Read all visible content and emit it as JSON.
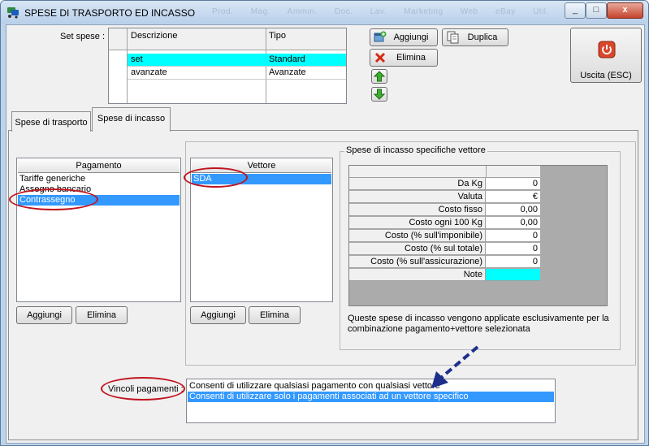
{
  "window": {
    "title": "SPESE DI TRASPORTO ED INCASSO",
    "background_menu": [
      "Prod.",
      "Mag.",
      "Ammin.",
      "Doc.",
      "Lav.",
      "Marketing",
      "Web",
      "eBay",
      "Util."
    ],
    "buttons": {
      "minimize": "_",
      "maximize": "□",
      "close": "x"
    }
  },
  "set_spese": {
    "label": "Set spese :",
    "columns": [
      "Descrizione",
      "Tipo"
    ],
    "rows": [
      {
        "descrizione": "set",
        "tipo": "Standard"
      },
      {
        "descrizione": "avanzate",
        "tipo": "Avanzate"
      }
    ]
  },
  "toolbar": {
    "aggiungi": "Aggiungi",
    "duplica": "Duplica",
    "elimina": "Elimina",
    "uscita": "Uscita (ESC)"
  },
  "tabs": [
    "Spese di trasporto",
    "Spese di incasso"
  ],
  "pagamento": {
    "header": "Pagamento",
    "items": [
      "Tariffe generiche",
      "Assegno bancario",
      "Contrassegno"
    ],
    "aggiungi": "Aggiungi",
    "elimina": "Elimina"
  },
  "vettore": {
    "header": "Vettore",
    "items": [
      "SDA"
    ],
    "aggiungi": "Aggiungi",
    "elimina": "Elimina"
  },
  "spese_specifiche": {
    "legend": "Spese di incasso specifiche vettore",
    "rows": [
      {
        "label": "Da Kg",
        "value": "0"
      },
      {
        "label": "Valuta",
        "value": "€"
      },
      {
        "label": "Costo fisso",
        "value": "0,00"
      },
      {
        "label": "Costo ogni 100 Kg",
        "value": "0,00"
      },
      {
        "label": "Costo (% sull'imponibile)",
        "value": "0"
      },
      {
        "label": "Costo (% sul totale)",
        "value": "0"
      },
      {
        "label": "Costo (% sull'assicurazione)",
        "value": "0"
      },
      {
        "label": "Note",
        "value": ""
      }
    ],
    "note_text": "Queste spese di incasso vengono applicate esclusivamente per la combinazione pagamento+vettore selezionata"
  },
  "vincoli": {
    "label": "Vincoli pagamenti :",
    "options": [
      "Consenti di utilizzare qualsiasi pagamento con qualsiasi vettore",
      "Consenti di utilizzare solo i pagamenti associati ad un vettore specifico"
    ]
  },
  "colors": {
    "grid_selection": "#00ffff",
    "list_selection": "#3399ff",
    "annotation_ellipse": "#c0141e",
    "annotation_arrow": "#1c2f8c",
    "note_cell": "#00ffff"
  }
}
